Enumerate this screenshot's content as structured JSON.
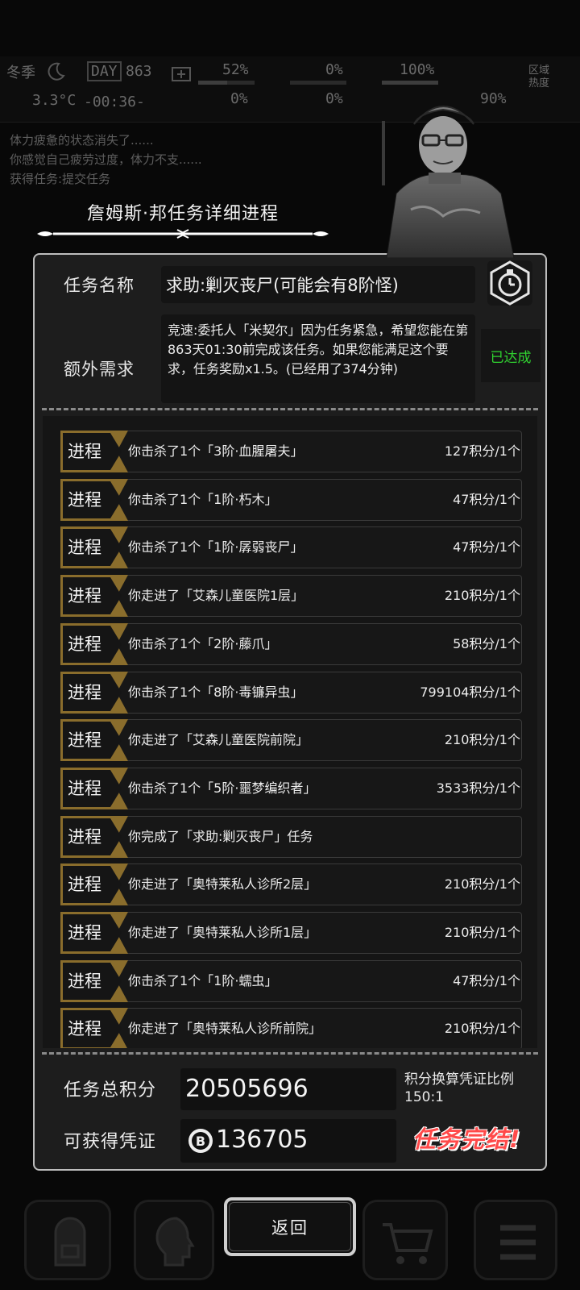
{
  "hud": {
    "season": "冬季",
    "day_label": "DAY",
    "day_number": "863",
    "temperature": "3.3°C",
    "clock": "-00:36-",
    "stats_top": [
      "52%",
      "0%",
      "100%"
    ],
    "stats_bottom": [
      "0%",
      "0%",
      "90%"
    ],
    "area_label": "区域热度",
    "log_lines": [
      "体力疲惫的状态消失了......",
      "你感觉自己疲劳过度，体力不支......",
      "获得任务:提交任务"
    ]
  },
  "dialog": {
    "title": "詹姆斯·邦任务详细进程",
    "task_name_label": "任务名称",
    "task_name": "求助:剿灭丧尸(可能会有8阶怪)",
    "extra_label": "额外需求",
    "extra_text": "竞速:委托人「米契尔」因为任务紧急，希望您能在第863天01:30前完成该任务。如果您能满足这个要求，任务奖励x1.5。(已经用了374分钟)",
    "extra_status": "已达成",
    "progress_tag": "进程",
    "progress": [
      {
        "desc": "你击杀了1个「3阶·血腥屠夫」",
        "points": "127积分/1个"
      },
      {
        "desc": "你击杀了1个「1阶·朽木」",
        "points": "47积分/1个"
      },
      {
        "desc": "你击杀了1个「1阶·孱弱丧尸」",
        "points": "47积分/1个"
      },
      {
        "desc": "你走进了「艾森儿童医院1层」",
        "points": "210积分/1个"
      },
      {
        "desc": "你击杀了1个「2阶·藤爪」",
        "points": "58积分/1个"
      },
      {
        "desc": "你击杀了1个「8阶·毒镰异虫」",
        "points": "799104积分/1个"
      },
      {
        "desc": "你走进了「艾森儿童医院前院」",
        "points": "210积分/1个"
      },
      {
        "desc": "你击杀了1个「5阶·噩梦编织者」",
        "points": "3533积分/1个"
      },
      {
        "desc": "你完成了「求助:剿灭丧尸」任务",
        "points": ""
      },
      {
        "desc": "你走进了「奥特莱私人诊所2层」",
        "points": "210积分/1个"
      },
      {
        "desc": "你走进了「奥特莱私人诊所1层」",
        "points": "210积分/1个"
      },
      {
        "desc": "你击杀了1个「1阶·蠕虫」",
        "points": "47积分/1个"
      },
      {
        "desc": "你走进了「奥特莱私人诊所前院」",
        "points": "210积分/1个"
      }
    ],
    "total_label": "任务总积分",
    "total_value": "20505696",
    "rate_label": "积分换算凭证比例",
    "rate_value": "150:1",
    "voucher_label": "可获得凭证",
    "voucher_value": "136705",
    "complete_label": "任务完结!",
    "back_label": "返回"
  },
  "colors": {
    "dialog_bg": "#1d1d1d",
    "dialog_border": "#bdbdbd",
    "status_green": "#30d230",
    "complete_red": "#ff4a4a",
    "tag_gold": "#8a6d2c"
  },
  "icons": [
    "moon-icon",
    "medkit-icon",
    "stopwatch-icon",
    "coin-icon",
    "backpack-icon",
    "brain-icon",
    "cart-icon",
    "menu-icon"
  ]
}
